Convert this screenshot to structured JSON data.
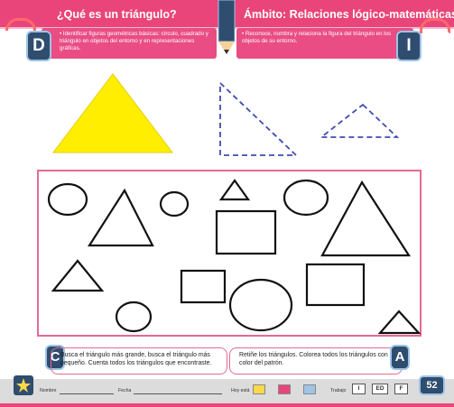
{
  "header": {
    "title_left": "¿Qué es un triángulo?",
    "title_right": "Ámbito: Relaciones lógico-matemáticas.",
    "badge_left": "D",
    "badge_right": "I",
    "bullet_left": "• Identificar figuras geométricas básicas: círculo, cuadrado y triángulo en objetos del entorno y en representaciones gráficas.",
    "bullet_right": "• Reconoce, nombra y relaciona la figura del triángulo en los objetos de su entorno."
  },
  "instructions": {
    "badge_left": "C",
    "badge_right": "A",
    "text_left": "Busca el triángulo más grande, busca el triángulo más pequeño. Cuenta todos los triángulos que encontraste.",
    "text_right": "Retiñe los triángulos. Colorea todos los triángulos con el color del patrón."
  },
  "footer": {
    "nombre_label": "Nombre",
    "fecha_label": "Fecha",
    "hoy_label": "Hoy está",
    "trabajo_label": "Trabajo",
    "box_i": "I",
    "box_ed": "ED",
    "box_f": "F",
    "page_number": "52"
  },
  "colors": {
    "accent_pink": "#e9457a",
    "triangle_fill": "#ffee00",
    "dashed_blue": "#3f4bb0",
    "badge_navy": "#2e4d6f"
  }
}
